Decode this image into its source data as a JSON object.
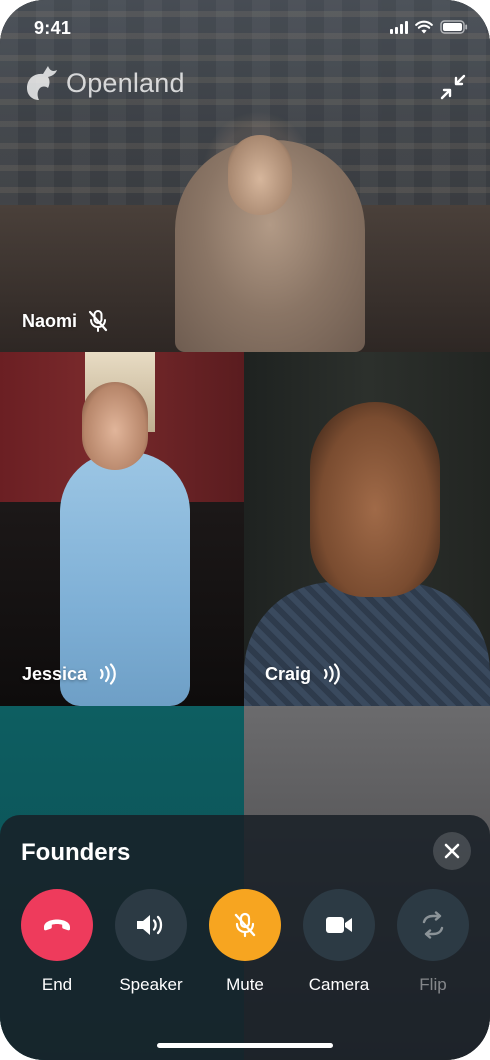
{
  "status_bar": {
    "time": "9:41",
    "icons": [
      "signal-icon",
      "wifi-icon",
      "battery-icon"
    ]
  },
  "app": {
    "logo_icon": "unicorn-logo-icon",
    "logo_text": "Openland"
  },
  "top_actions": {
    "collapse_icon": "collapse-arrows-icon"
  },
  "participants": [
    {
      "name": "Naomi",
      "status_icon": "mic-off-icon",
      "speaking": false,
      "muted": true
    },
    {
      "name": "Jessica",
      "status_icon": "speaking-waves-icon",
      "speaking": true,
      "muted": false
    },
    {
      "name": "Craig",
      "status_icon": "speaking-waves-icon",
      "speaking": true,
      "muted": false
    }
  ],
  "call_sheet": {
    "title": "Founders",
    "close_icon": "close-icon",
    "controls": [
      {
        "label": "End",
        "icon": "phone-hangup-icon",
        "color": "#ee3b5c",
        "active": true
      },
      {
        "label": "Speaker",
        "icon": "speaker-icon",
        "color": "#2c3a44",
        "active": true
      },
      {
        "label": "Mute",
        "icon": "mic-off-icon",
        "color": "#f7a520",
        "active": true
      },
      {
        "label": "Camera",
        "icon": "video-camera-icon",
        "color": "#2c3a44",
        "active": true
      },
      {
        "label": "Flip",
        "icon": "flip-camera-icon",
        "color": "#2c3a44",
        "active": false
      }
    ]
  },
  "colors": {
    "end_red": "#ee3b5c",
    "mute_orange": "#f7a520",
    "sheet_bg": "#182026"
  }
}
